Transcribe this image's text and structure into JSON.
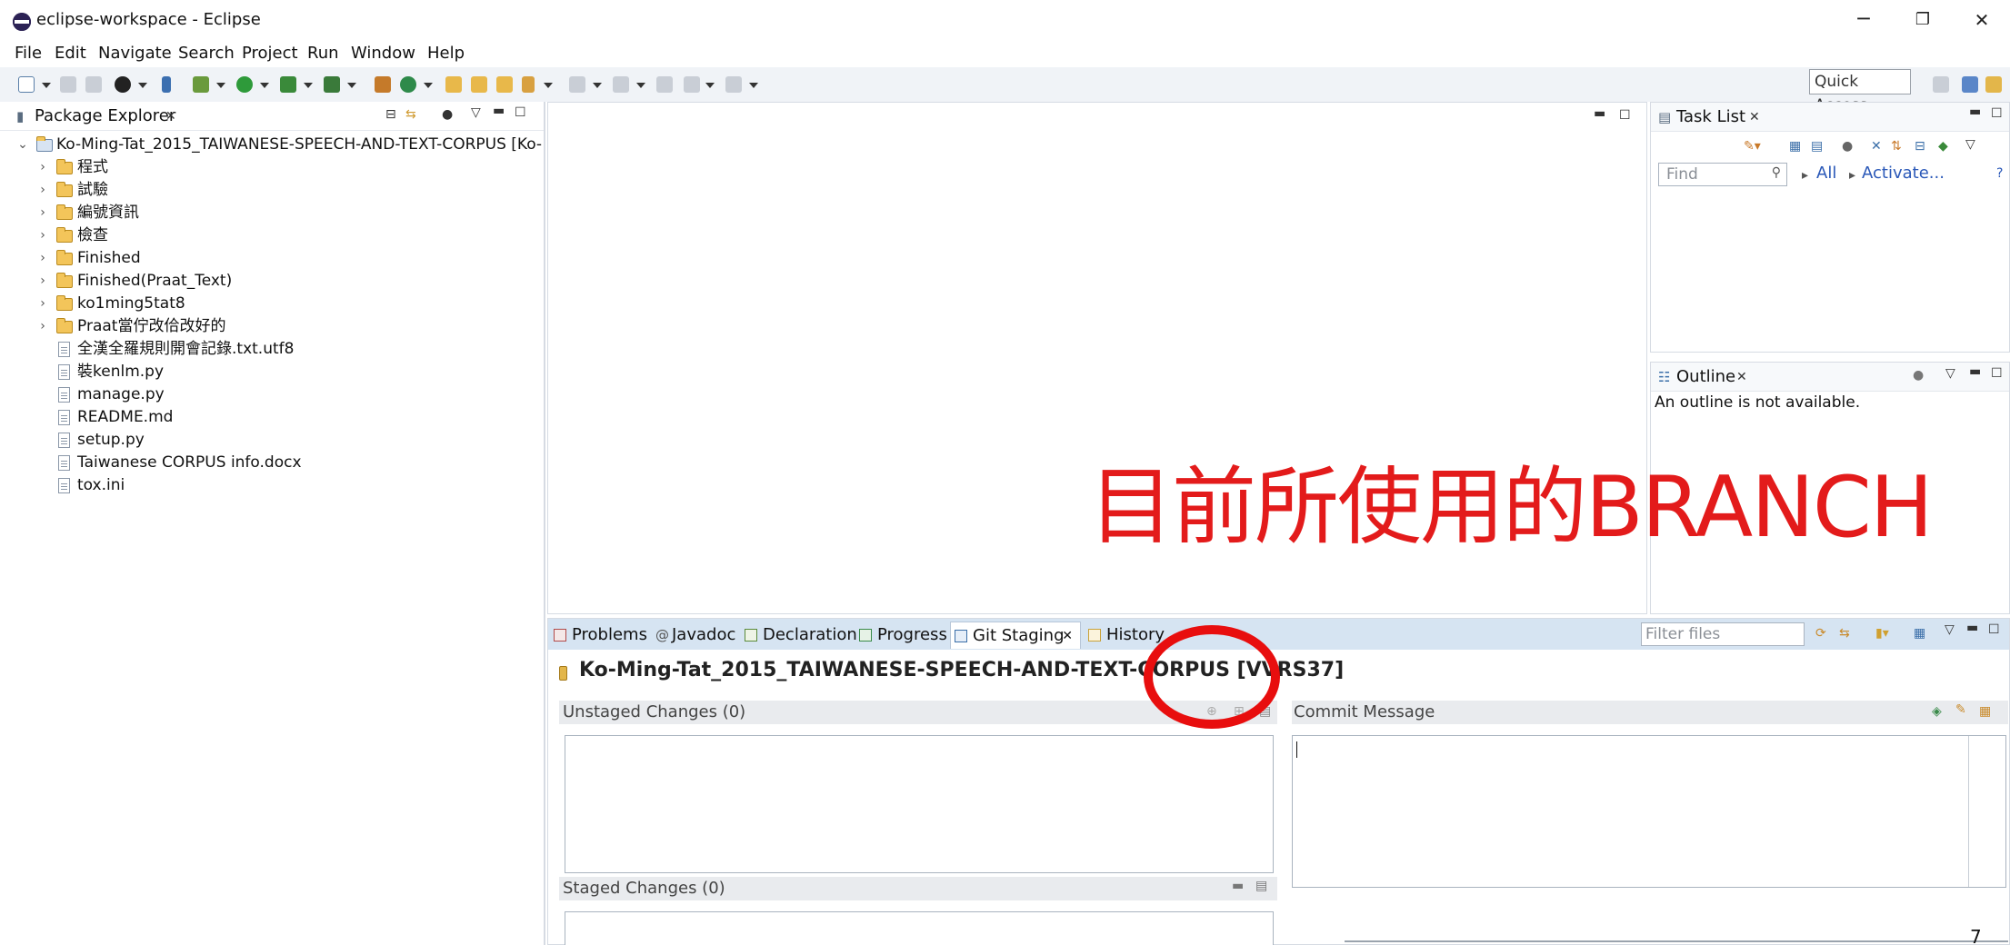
{
  "window": {
    "title": "eclipse-workspace - Eclipse",
    "minimize": "─",
    "restore": "❐",
    "close": "✕"
  },
  "menu": [
    "File",
    "Edit",
    "Navigate",
    "Search",
    "Project",
    "Run",
    "Window",
    "Help"
  ],
  "toolbar": {
    "quick_access": "Quick Access"
  },
  "explorer": {
    "title": "Package Explorer",
    "project": "Ko-Ming-Tat_2015_TAIWANESE-SPEECH-AND-TEXT-CORPUS [Ko-",
    "folders": [
      "程式",
      "試驗",
      "編號資訊",
      "檢查",
      "Finished",
      "Finished(Praat_Text)",
      "ko1ming5tat8",
      "Praat當佇改佮改好的"
    ],
    "files": [
      "全漢全羅規則開會記錄.txt.utf8",
      "裝kenlm.py",
      "manage.py",
      "README.md",
      "setup.py",
      "Taiwanese CORPUS info.docx",
      "tox.ini"
    ]
  },
  "tasklist": {
    "title": "Task List",
    "find_placeholder": "Find",
    "all_link": "All",
    "activate_link": "Activate..."
  },
  "outline": {
    "title": "Outline",
    "message": "An outline is not available."
  },
  "bottom": {
    "tabs": [
      "Problems",
      "Javadoc",
      "Declaration",
      "Progress",
      "Git Staging",
      "History"
    ],
    "filter_placeholder": "Filter files",
    "repo": "Ko-Ming-Tat_2015_TAIWANESE-SPEECH-AND-TEXT-CORPUS [VVRS37]",
    "unstaged": "Unstaged Changes (0)",
    "staged": "Staged Changes (0)",
    "commit": "Commit Message"
  },
  "annotation": {
    "text": "目前所使用的BRANCH",
    "color": "#e31b1b"
  },
  "slide_number": "7"
}
